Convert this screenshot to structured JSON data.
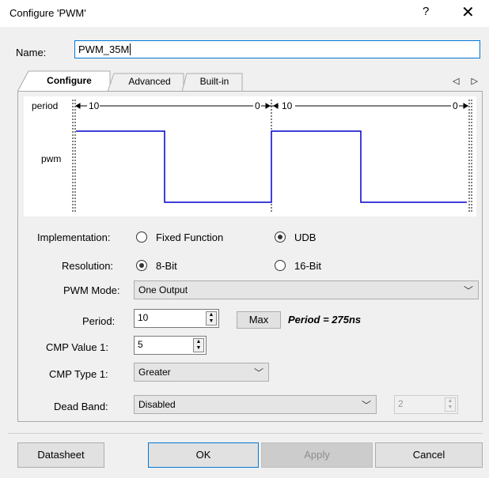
{
  "window": {
    "title": "Configure 'PWM'",
    "help": "?",
    "close": "✕"
  },
  "name": {
    "label": "Name:",
    "value": "PWM_35M"
  },
  "tabs": [
    {
      "label": "Configure"
    },
    {
      "label": "Advanced"
    },
    {
      "label": "Built-in"
    }
  ],
  "tab_arrows": "◁ ▷",
  "waveform": {
    "period_label": "period",
    "pwm_label": "pwm",
    "count_start_1": "10",
    "count_end_1": "0",
    "count_start_2": "10",
    "count_end_2": "0",
    "signal_color": "#0000cc"
  },
  "implementation": {
    "label": "Implementation:",
    "options": [
      "Fixed Function",
      "UDB"
    ],
    "selected": "UDB"
  },
  "resolution": {
    "label": "Resolution:",
    "options": [
      "8-Bit",
      "16-Bit"
    ],
    "selected": "8-Bit"
  },
  "pwm_mode": {
    "label": "PWM Mode:",
    "value": "One Output"
  },
  "period": {
    "label": "Period:",
    "value": "10",
    "max_button": "Max",
    "info": "Period = 275ns"
  },
  "cmp_value1": {
    "label": "CMP Value 1:",
    "value": "5"
  },
  "cmp_type1": {
    "label": "CMP Type 1:",
    "value": "Greater"
  },
  "dead_band": {
    "label": "Dead Band:",
    "value": "Disabled",
    "spin_value": "2"
  },
  "buttons": {
    "datasheet": "Datasheet",
    "ok": "OK",
    "apply": "Apply",
    "cancel": "Cancel"
  }
}
